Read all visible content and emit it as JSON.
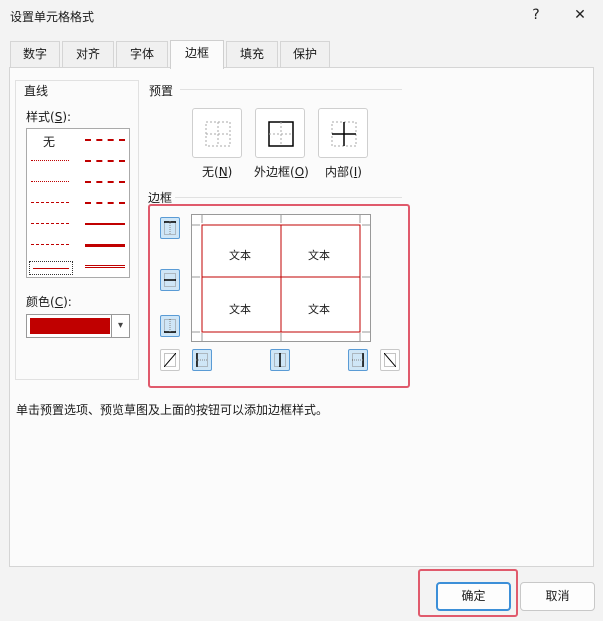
{
  "window": {
    "title": "设置单元格格式",
    "help_glyph": "?",
    "close_glyph": "✕"
  },
  "tabs": [
    {
      "label": "数字"
    },
    {
      "label": "对齐"
    },
    {
      "label": "字体"
    },
    {
      "label": "边框"
    },
    {
      "label": "填充"
    },
    {
      "label": "保护"
    }
  ],
  "active_tab": "边框",
  "line_section": {
    "title": "直线",
    "style_label_pre": "样式(",
    "style_label_key": "S",
    "style_label_post": "):",
    "none_label": "无",
    "color_label_pre": "颜色(",
    "color_label_key": "C",
    "color_label_post": "):",
    "selected_color": "#c00000",
    "dropdown_glyph": "▾"
  },
  "presets": {
    "title": "预置",
    "items": [
      {
        "label_pre": "无(",
        "key": "N",
        "label_post": ")",
        "icon": "no-border-icon"
      },
      {
        "label_pre": "外边框(",
        "key": "O",
        "label_post": ")",
        "icon": "outline-border-icon"
      },
      {
        "label_pre": "内部(",
        "key": "I",
        "label_post": ")",
        "icon": "inside-border-icon"
      }
    ]
  },
  "border_section": {
    "title": "边框",
    "preview_cells": [
      "文本",
      "文本",
      "文本",
      "文本"
    ],
    "line_color": "#c00000"
  },
  "hint": "单击预置选项、预览草图及上面的按钮可以添加边框样式。",
  "buttons": {
    "ok": "确定",
    "cancel": "取消"
  },
  "colors": {
    "accent": "#3c8fd8",
    "highlight": "#e05a6c",
    "border_red": "#c00000"
  }
}
